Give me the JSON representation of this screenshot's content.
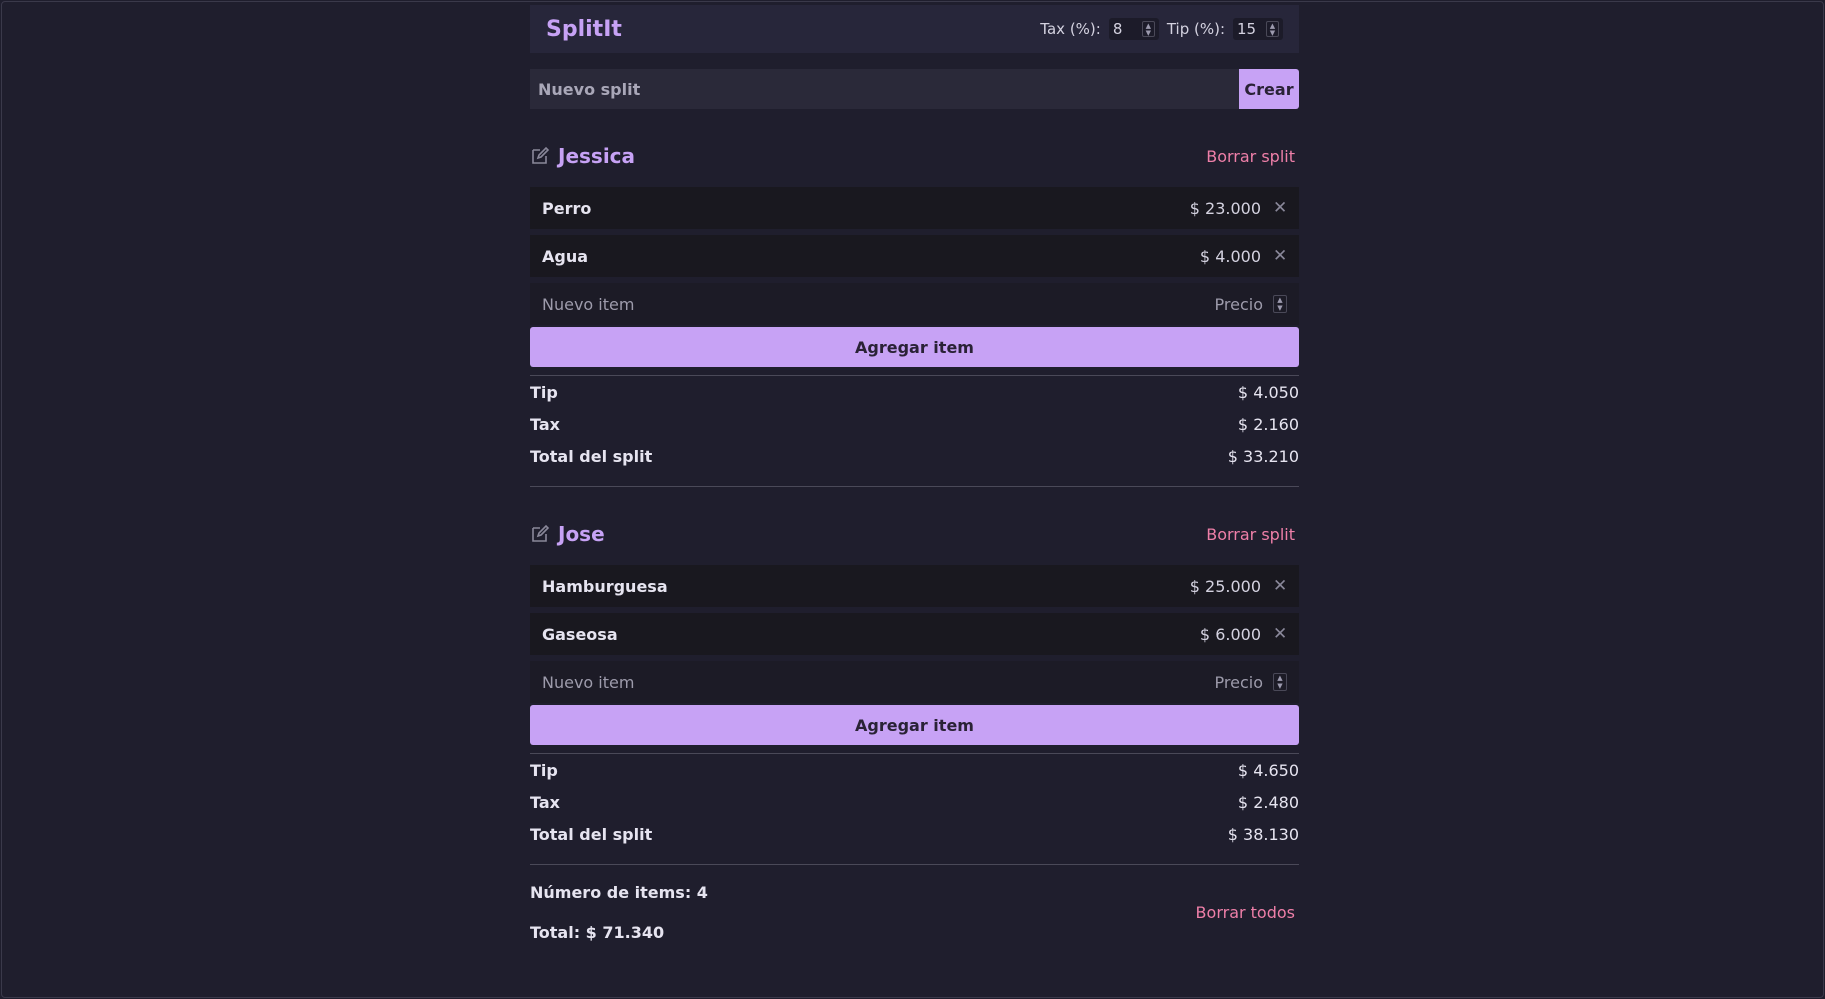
{
  "app": {
    "title": "SplitIt"
  },
  "settings": {
    "tax_label": "Tax (%):",
    "tax_value": "8",
    "tip_label": "Tip (%):",
    "tip_value": "15"
  },
  "new_split": {
    "placeholder": "Nuevo split",
    "button": "Crear"
  },
  "splits": [
    {
      "name": "Jessica",
      "delete_label": "Borrar split",
      "items": [
        {
          "name": "Perro",
          "price": "$ 23.000"
        },
        {
          "name": "Agua",
          "price": "$ 4.000"
        }
      ],
      "new_item_placeholder": "Nuevo item",
      "price_placeholder": "Precio",
      "add_button": "Agregar item",
      "summary": {
        "tip_label": "Tip",
        "tip": "$ 4.050",
        "tax_label": "Tax",
        "tax": "$ 2.160",
        "total_label": "Total del split",
        "total": "$ 33.210"
      }
    },
    {
      "name": "Jose",
      "delete_label": "Borrar split",
      "items": [
        {
          "name": "Hamburguesa",
          "price": "$ 25.000"
        },
        {
          "name": "Gaseosa",
          "price": "$ 6.000"
        }
      ],
      "new_item_placeholder": "Nuevo item",
      "price_placeholder": "Precio",
      "add_button": "Agregar item",
      "summary": {
        "tip_label": "Tip",
        "tip": "$ 4.650",
        "tax_label": "Tax",
        "tax": "$ 2.480",
        "total_label": "Total del split",
        "total": "$ 38.130"
      }
    }
  ],
  "footer": {
    "count": "Número de items: 4",
    "total": "Total: $ 71.340",
    "delete_all": "Borrar todos"
  },
  "icons": {
    "edit": "edit-icon",
    "remove": "close-icon",
    "spinner": "spinner-icon"
  },
  "colors": {
    "accent": "#c7a2f5",
    "danger": "#ee7fa8",
    "background": "#1f1e2d"
  }
}
